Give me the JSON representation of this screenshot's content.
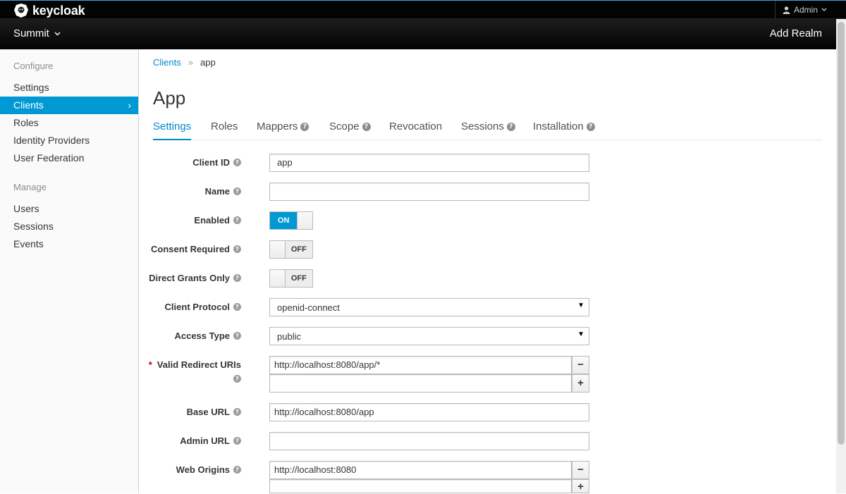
{
  "brand": {
    "name": "keycloak"
  },
  "user_menu": {
    "label": "Admin"
  },
  "navbar": {
    "realm": "Summit",
    "add_realm": "Add Realm"
  },
  "sidebar": {
    "configure_heading": "Configure",
    "configure_items": [
      {
        "label": "Settings"
      },
      {
        "label": "Clients",
        "active": true
      },
      {
        "label": "Roles"
      },
      {
        "label": "Identity Providers"
      },
      {
        "label": "User Federation"
      }
    ],
    "manage_heading": "Manage",
    "manage_items": [
      {
        "label": "Users"
      },
      {
        "label": "Sessions"
      },
      {
        "label": "Events"
      }
    ]
  },
  "breadcrumb": {
    "parent": "Clients",
    "separator": "»",
    "current": "app"
  },
  "page_title": "App",
  "tabs": [
    {
      "label": "Settings",
      "active": true,
      "help": false
    },
    {
      "label": "Roles",
      "help": false
    },
    {
      "label": "Mappers",
      "help": true
    },
    {
      "label": "Scope",
      "help": true
    },
    {
      "label": "Revocation",
      "help": false
    },
    {
      "label": "Sessions",
      "help": true
    },
    {
      "label": "Installation",
      "help": true
    }
  ],
  "form": {
    "client_id": {
      "label": "Client ID",
      "value": "app"
    },
    "name": {
      "label": "Name",
      "value": ""
    },
    "enabled": {
      "label": "Enabled",
      "state": "ON"
    },
    "consent_required": {
      "label": "Consent Required",
      "state": "OFF"
    },
    "direct_grants_only": {
      "label": "Direct Grants Only",
      "state": "OFF"
    },
    "client_protocol": {
      "label": "Client Protocol",
      "value": "openid-connect"
    },
    "access_type": {
      "label": "Access Type",
      "value": "public"
    },
    "valid_redirect_uris": {
      "label": "Valid Redirect URIs",
      "required_mark": "*",
      "values": [
        "http://localhost:8080/app/*",
        ""
      ]
    },
    "base_url": {
      "label": "Base URL",
      "value": "http://localhost:8080/app"
    },
    "admin_url": {
      "label": "Admin URL",
      "value": ""
    },
    "web_origins": {
      "label": "Web Origins",
      "values": [
        "http://localhost:8080",
        ""
      ]
    }
  },
  "icons": {
    "help": "?",
    "remove": "−",
    "add": "+",
    "chevron_right": "›",
    "chevron_down": "⌄"
  },
  "colors": {
    "accent": "#0088ce",
    "active_bg": "#0099d3",
    "navbar_bg": "#030303",
    "required": "#cc0000"
  }
}
